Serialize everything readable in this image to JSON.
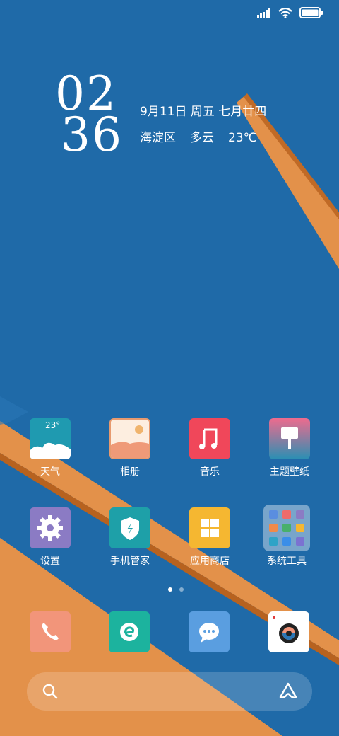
{
  "status_bar": {
    "signal_icon": "signal-bars-icon",
    "wifi_icon": "wifi-icon",
    "battery_icon": "battery-icon",
    "battery_level": 1.0
  },
  "clock": {
    "hours": "02",
    "minutes": "36"
  },
  "date_info": {
    "date": "9月11日 周五 七月廿四",
    "district": "海淀区",
    "weather": "多云",
    "temperature": "23℃"
  },
  "apps_row1": [
    {
      "label": "天气",
      "icon": "weather-icon",
      "badge": "23°"
    },
    {
      "label": "相册",
      "icon": "gallery-icon"
    },
    {
      "label": "音乐",
      "icon": "music-icon"
    },
    {
      "label": "主题壁纸",
      "icon": "themes-icon"
    }
  ],
  "apps_row2": [
    {
      "label": "设置",
      "icon": "settings-icon"
    },
    {
      "label": "手机管家",
      "icon": "security-icon"
    },
    {
      "label": "应用商店",
      "icon": "app-store-icon"
    },
    {
      "label": "系统工具",
      "icon": "tools-folder-icon"
    }
  ],
  "page_indicator": {
    "pages": 2,
    "current": 1
  },
  "dock": [
    {
      "icon": "phone-icon"
    },
    {
      "icon": "browser-icon"
    },
    {
      "icon": "messages-icon"
    },
    {
      "icon": "camera-icon"
    }
  ],
  "search_bar": {
    "left_icon": "search-icon",
    "right_icon": "assistant-icon"
  },
  "colors": {
    "wallpaper_blue": "#1f6aa8",
    "wallpaper_orange": "#e3914a"
  }
}
